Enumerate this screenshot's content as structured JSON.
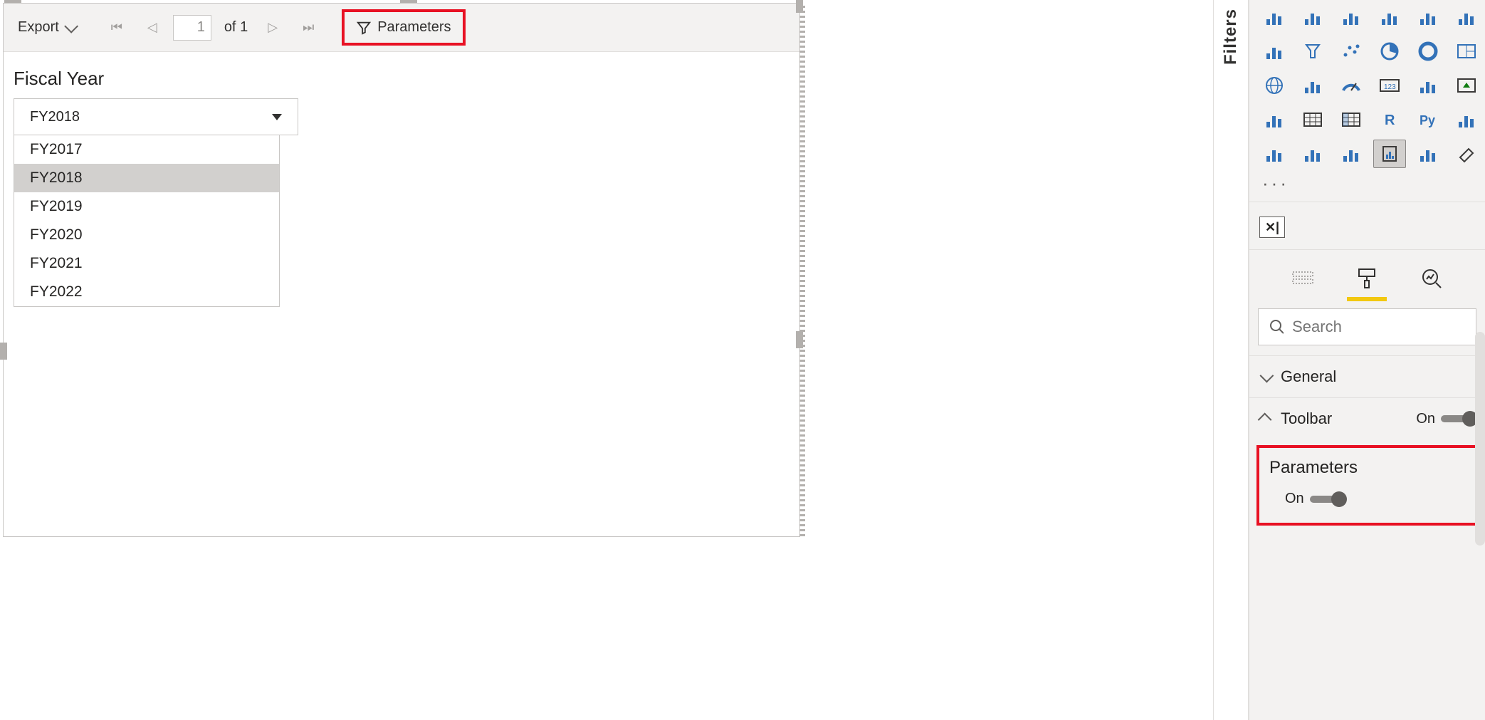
{
  "toolbar": {
    "export_label": "Export",
    "page_input": "1",
    "page_of_prefix": "of",
    "page_total": "1",
    "parameters_label": "Parameters"
  },
  "report": {
    "param_label": "Fiscal Year",
    "selected": "FY2018",
    "options": [
      "FY2017",
      "FY2018",
      "FY2019",
      "FY2020",
      "FY2021",
      "FY2022"
    ]
  },
  "filters_tab": "Filters",
  "viz_gallery": [
    "stacked-area",
    "area",
    "line-stacked",
    "line-clustered",
    "ribbon",
    "waterfall",
    "funnel-h",
    "funnel",
    "scatter",
    "pie",
    "donut",
    "treemap",
    "globe",
    "filled-map",
    "gauge",
    "card",
    "multi-row-card",
    "kpi",
    "slicer",
    "table",
    "matrix",
    "r-visual",
    "python-visual",
    "key-influencers",
    "decomposition",
    "qna",
    "paginated",
    "paginated-report",
    "arcgis",
    "eraser"
  ],
  "tabs": {
    "fields": "fields",
    "format": "format",
    "analytics": "analytics"
  },
  "search": {
    "placeholder": "Search"
  },
  "format": {
    "general_label": "General",
    "toolbar_label": "Toolbar",
    "toolbar_state": "On",
    "parameters_label": "Parameters",
    "parameters_state": "On"
  }
}
